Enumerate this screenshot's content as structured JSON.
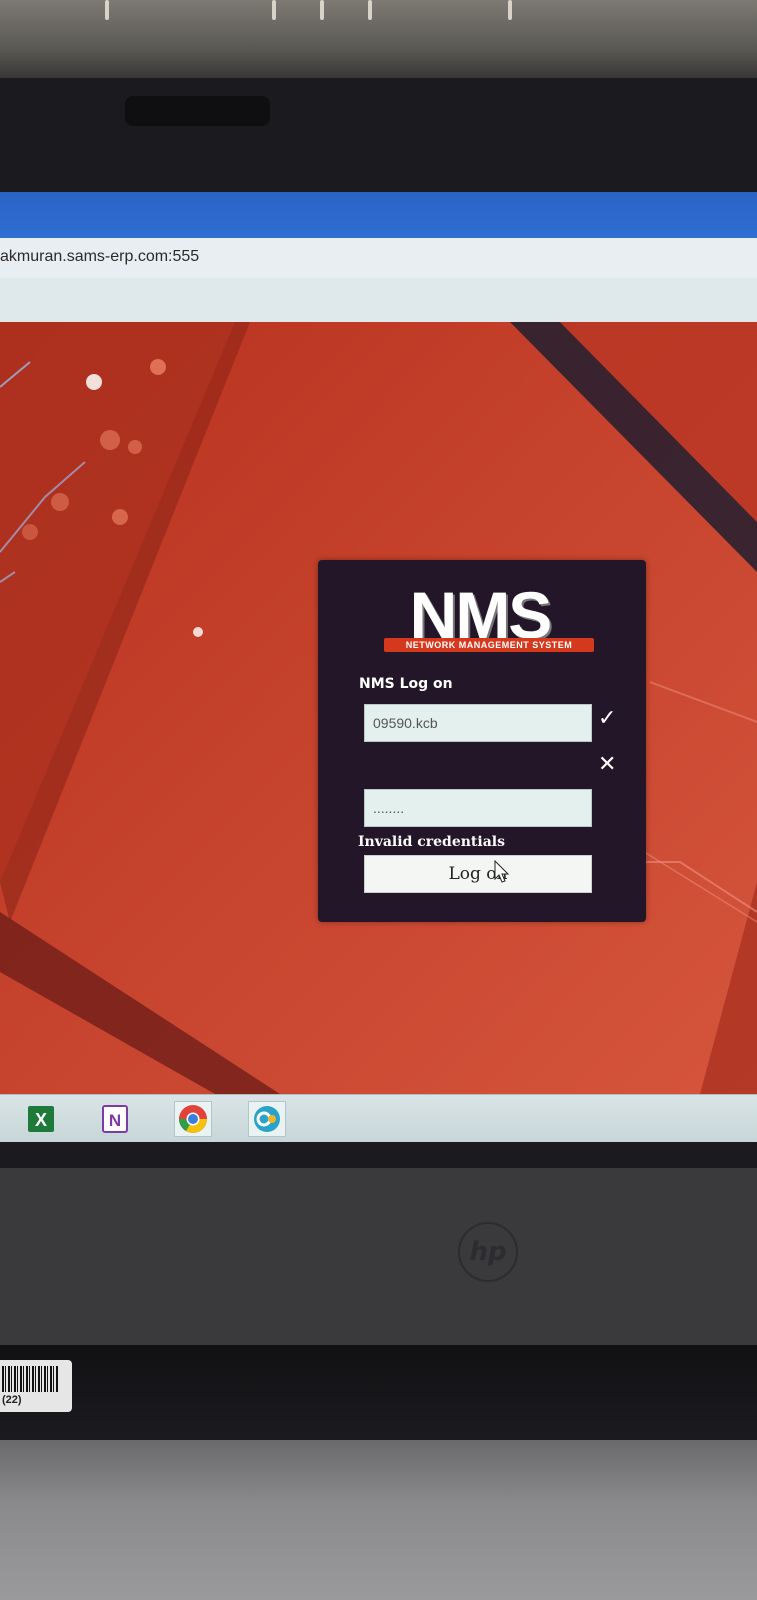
{
  "browser": {
    "url": "akmuran.sams-erp.com:555"
  },
  "login": {
    "logo_title": "NMS",
    "logo_subtitle": "NETWORK MANAGEMENT SYSTEM",
    "heading": "NMS Log on",
    "username_value": "09590.kcb",
    "password_value": "........",
    "username_status_icon": "check-icon",
    "password_status_icon": "x-icon",
    "error_message": "Invalid credentials",
    "logon_button_label": "Log on"
  },
  "taskbar": {
    "items": [
      {
        "name": "excel-icon",
        "letter": "X",
        "color": "#1f7a3a"
      },
      {
        "name": "onenote-icon",
        "letter": "N",
        "color": "#7b3ba8"
      },
      {
        "name": "chrome-icon",
        "letter": "",
        "color": "#e1423a"
      },
      {
        "name": "app-icon",
        "letter": "",
        "color": "#2aa3c9"
      }
    ]
  },
  "device": {
    "brand_logo": "hp",
    "barcode_label": "(22)"
  },
  "colors": {
    "background_red": "#c8432d",
    "panel_dark": "#231628",
    "titlebar_blue": "#2f6ed3",
    "logo_accent": "#d4391e"
  }
}
